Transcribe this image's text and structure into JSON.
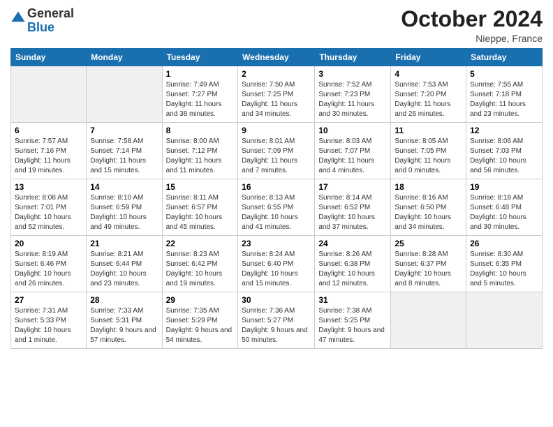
{
  "header": {
    "logo_general": "General",
    "logo_blue": "Blue",
    "month_title": "October 2024",
    "subtitle": "Nieppe, France"
  },
  "days_of_week": [
    "Sunday",
    "Monday",
    "Tuesday",
    "Wednesday",
    "Thursday",
    "Friday",
    "Saturday"
  ],
  "weeks": [
    [
      {
        "num": "",
        "info": ""
      },
      {
        "num": "",
        "info": ""
      },
      {
        "num": "1",
        "info": "Sunrise: 7:49 AM\nSunset: 7:27 PM\nDaylight: 11 hours and 38 minutes."
      },
      {
        "num": "2",
        "info": "Sunrise: 7:50 AM\nSunset: 7:25 PM\nDaylight: 11 hours and 34 minutes."
      },
      {
        "num": "3",
        "info": "Sunrise: 7:52 AM\nSunset: 7:23 PM\nDaylight: 11 hours and 30 minutes."
      },
      {
        "num": "4",
        "info": "Sunrise: 7:53 AM\nSunset: 7:20 PM\nDaylight: 11 hours and 26 minutes."
      },
      {
        "num": "5",
        "info": "Sunrise: 7:55 AM\nSunset: 7:18 PM\nDaylight: 11 hours and 23 minutes."
      }
    ],
    [
      {
        "num": "6",
        "info": "Sunrise: 7:57 AM\nSunset: 7:16 PM\nDaylight: 11 hours and 19 minutes."
      },
      {
        "num": "7",
        "info": "Sunrise: 7:58 AM\nSunset: 7:14 PM\nDaylight: 11 hours and 15 minutes."
      },
      {
        "num": "8",
        "info": "Sunrise: 8:00 AM\nSunset: 7:12 PM\nDaylight: 11 hours and 11 minutes."
      },
      {
        "num": "9",
        "info": "Sunrise: 8:01 AM\nSunset: 7:09 PM\nDaylight: 11 hours and 7 minutes."
      },
      {
        "num": "10",
        "info": "Sunrise: 8:03 AM\nSunset: 7:07 PM\nDaylight: 11 hours and 4 minutes."
      },
      {
        "num": "11",
        "info": "Sunrise: 8:05 AM\nSunset: 7:05 PM\nDaylight: 11 hours and 0 minutes."
      },
      {
        "num": "12",
        "info": "Sunrise: 8:06 AM\nSunset: 7:03 PM\nDaylight: 10 hours and 56 minutes."
      }
    ],
    [
      {
        "num": "13",
        "info": "Sunrise: 8:08 AM\nSunset: 7:01 PM\nDaylight: 10 hours and 52 minutes."
      },
      {
        "num": "14",
        "info": "Sunrise: 8:10 AM\nSunset: 6:59 PM\nDaylight: 10 hours and 49 minutes."
      },
      {
        "num": "15",
        "info": "Sunrise: 8:11 AM\nSunset: 6:57 PM\nDaylight: 10 hours and 45 minutes."
      },
      {
        "num": "16",
        "info": "Sunrise: 8:13 AM\nSunset: 6:55 PM\nDaylight: 10 hours and 41 minutes."
      },
      {
        "num": "17",
        "info": "Sunrise: 8:14 AM\nSunset: 6:52 PM\nDaylight: 10 hours and 37 minutes."
      },
      {
        "num": "18",
        "info": "Sunrise: 8:16 AM\nSunset: 6:50 PM\nDaylight: 10 hours and 34 minutes."
      },
      {
        "num": "19",
        "info": "Sunrise: 8:18 AM\nSunset: 6:48 PM\nDaylight: 10 hours and 30 minutes."
      }
    ],
    [
      {
        "num": "20",
        "info": "Sunrise: 8:19 AM\nSunset: 6:46 PM\nDaylight: 10 hours and 26 minutes."
      },
      {
        "num": "21",
        "info": "Sunrise: 8:21 AM\nSunset: 6:44 PM\nDaylight: 10 hours and 23 minutes."
      },
      {
        "num": "22",
        "info": "Sunrise: 8:23 AM\nSunset: 6:42 PM\nDaylight: 10 hours and 19 minutes."
      },
      {
        "num": "23",
        "info": "Sunrise: 8:24 AM\nSunset: 6:40 PM\nDaylight: 10 hours and 15 minutes."
      },
      {
        "num": "24",
        "info": "Sunrise: 8:26 AM\nSunset: 6:38 PM\nDaylight: 10 hours and 12 minutes."
      },
      {
        "num": "25",
        "info": "Sunrise: 8:28 AM\nSunset: 6:37 PM\nDaylight: 10 hours and 8 minutes."
      },
      {
        "num": "26",
        "info": "Sunrise: 8:30 AM\nSunset: 6:35 PM\nDaylight: 10 hours and 5 minutes."
      }
    ],
    [
      {
        "num": "27",
        "info": "Sunrise: 7:31 AM\nSunset: 5:33 PM\nDaylight: 10 hours and 1 minute."
      },
      {
        "num": "28",
        "info": "Sunrise: 7:33 AM\nSunset: 5:31 PM\nDaylight: 9 hours and 57 minutes."
      },
      {
        "num": "29",
        "info": "Sunrise: 7:35 AM\nSunset: 5:29 PM\nDaylight: 9 hours and 54 minutes."
      },
      {
        "num": "30",
        "info": "Sunrise: 7:36 AM\nSunset: 5:27 PM\nDaylight: 9 hours and 50 minutes."
      },
      {
        "num": "31",
        "info": "Sunrise: 7:38 AM\nSunset: 5:25 PM\nDaylight: 9 hours and 47 minutes."
      },
      {
        "num": "",
        "info": ""
      },
      {
        "num": "",
        "info": ""
      }
    ]
  ]
}
